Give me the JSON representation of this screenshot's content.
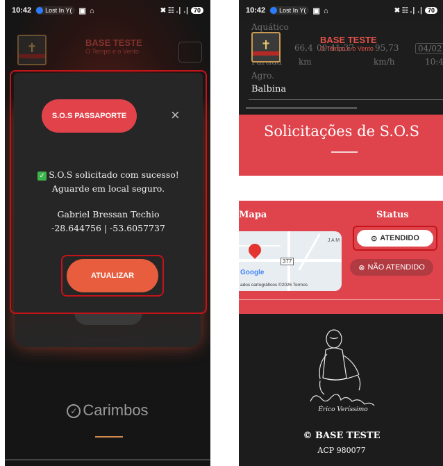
{
  "status_bar": {
    "time": "10:42",
    "now_playing": "Lost In Y(",
    "signal_text": "✖ ☷ .∣ .∣",
    "battery": "70"
  },
  "app": {
    "brand_title": "BASE TESTE",
    "brand_subtitle": "O Tempo e o Vento"
  },
  "left_screen": {
    "modal": {
      "sos_button": "S.O.S PASSAPORTE",
      "close_glyph": "×",
      "success_line1": "S.O.S solicitado com sucesso!",
      "success_line2": "Aguarde em local seguro.",
      "person_name": "Gabriel Bressan Techio",
      "coordinates": "-28.644756 | -53.6057737",
      "update_button": "ATUALIZAR"
    },
    "section_title": "Carimbos",
    "check_glyph": "✓"
  },
  "right_screen": {
    "background_rows": {
      "aquatico": "Aquático",
      "val1": "66,4",
      "duration": "00:41:37",
      "val2": "95,73",
      "date": "04/02",
      "partida": "Partida",
      "km": "km",
      "kmh": "km/h",
      "time2": "10:4",
      "agro": "Agro."
    },
    "location_value": "Balbina",
    "section_title": "Solicitações de S.O.S",
    "col_map": "Mapa",
    "col_status": "Status",
    "map": {
      "google_logo": "Google",
      "attribution": "ados cartográficos ©2026   Termos",
      "route_shield": "377",
      "place_label": "J A M"
    },
    "status_attended": "ATENDIDO",
    "status_not_attended": "NÃO ATENDIDO",
    "signature": "Érico Veríssimo",
    "copyright": "© BASE TESTE",
    "acp": "ACP 980077"
  },
  "colors": {
    "accent_red": "#df444c",
    "accent_orange": "#e85d3e",
    "highlight_outline": "#c4141a",
    "success_check": "#3cb44b"
  }
}
